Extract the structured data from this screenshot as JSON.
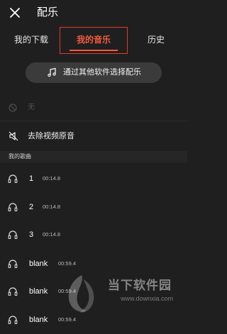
{
  "header": {
    "title": "配乐"
  },
  "tabs": [
    {
      "label": "我的下载"
    },
    {
      "label": "我的音乐"
    },
    {
      "label": "历史"
    }
  ],
  "pick_button": {
    "label": "通过其他软件选择配乐"
  },
  "none_option": {
    "label": "无"
  },
  "remove_original": {
    "label": "去除视频原音"
  },
  "section": {
    "label": "我的歌曲"
  },
  "songs": [
    {
      "name": "1",
      "duration": "00:14.8"
    },
    {
      "name": "2",
      "duration": "00:14.8"
    },
    {
      "name": "3",
      "duration": "00:14.8"
    },
    {
      "name": "blank",
      "duration": "00:59.4"
    },
    {
      "name": "blank",
      "duration": "00:59.4"
    },
    {
      "name": "blank",
      "duration": "00:59.4"
    }
  ],
  "watermark": {
    "text": "当下软件园",
    "url": "www.downxia.com"
  },
  "colors": {
    "accent": "#f05a3e",
    "highlight_box": "#e23a2a",
    "background": "#1f1f1f"
  }
}
